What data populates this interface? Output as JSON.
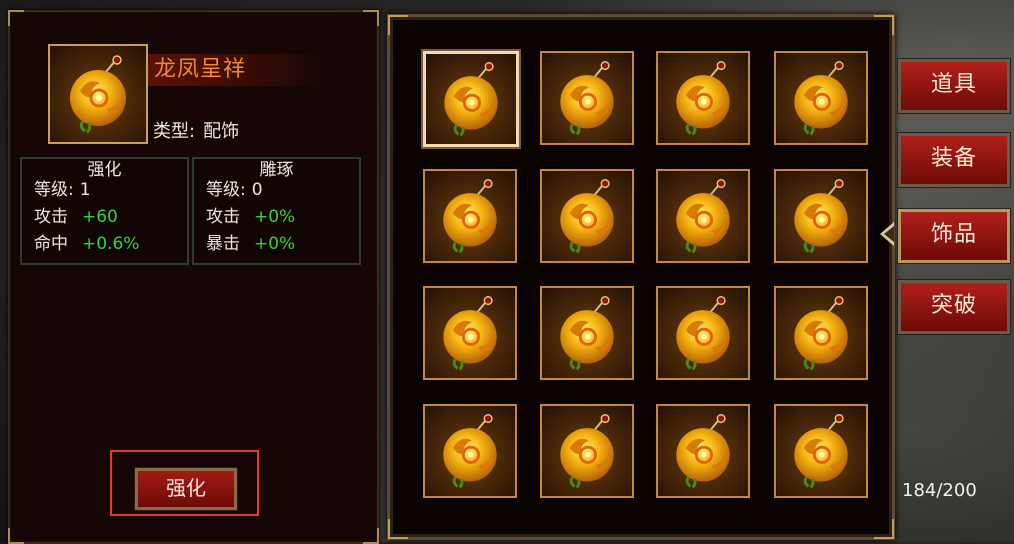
{
  "detail": {
    "item_name": "龙凤呈祥",
    "type_label": "类型:",
    "type_value": "配饰",
    "enhance": {
      "title": "强化",
      "rows": [
        {
          "label": "等级:",
          "value": "1",
          "bonus": ""
        },
        {
          "label": "攻击",
          "value": "",
          "bonus": "+60"
        },
        {
          "label": "命中",
          "value": "",
          "bonus": "+0.6%"
        }
      ]
    },
    "carve": {
      "title": "雕琢",
      "rows": [
        {
          "label": "等级:",
          "value": "0",
          "bonus": ""
        },
        {
          "label": "攻击",
          "value": "",
          "bonus": "+0%"
        },
        {
          "label": "暴击",
          "value": "",
          "bonus": "+0%"
        }
      ]
    },
    "enhance_button": "强化"
  },
  "grid": {
    "selected_index": 0,
    "slots": [
      {
        "icon": "jade-pendant-icon"
      },
      {
        "icon": "jade-pendant-icon"
      },
      {
        "icon": "jade-pendant-icon"
      },
      {
        "icon": "jade-pendant-icon"
      },
      {
        "icon": "jade-pendant-icon"
      },
      {
        "icon": "jade-pendant-icon"
      },
      {
        "icon": "jade-pendant-icon"
      },
      {
        "icon": "jade-pendant-icon"
      },
      {
        "icon": "jade-pendant-icon"
      },
      {
        "icon": "jade-pendant-icon"
      },
      {
        "icon": "jade-pendant-icon"
      },
      {
        "icon": "jade-pendant-icon"
      },
      {
        "icon": "jade-pendant-icon"
      },
      {
        "icon": "jade-pendant-icon"
      },
      {
        "icon": "jade-pendant-icon"
      },
      {
        "icon": "jade-pendant-icon"
      }
    ]
  },
  "tabs": [
    {
      "label": "道具",
      "active": false
    },
    {
      "label": "装备",
      "active": false
    },
    {
      "label": "饰品",
      "active": true
    },
    {
      "label": "突破",
      "active": false
    }
  ],
  "capacity": "184/200",
  "colors": {
    "item_name": "#f08a30",
    "bonus": "#39d12e",
    "highlight": "#e53a3a",
    "tab_red": "#b0201a"
  }
}
